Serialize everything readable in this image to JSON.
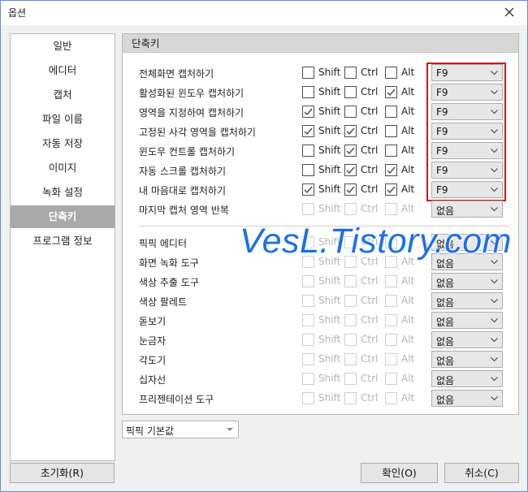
{
  "window": {
    "title": "옵션"
  },
  "sidebar": {
    "items": [
      {
        "label": "일반"
      },
      {
        "label": "에디터"
      },
      {
        "label": "캡처"
      },
      {
        "label": "파일 이름"
      },
      {
        "label": "자동 저장"
      },
      {
        "label": "이미지"
      },
      {
        "label": "녹화 설정"
      },
      {
        "label": "단축키",
        "active": true
      },
      {
        "label": "프로그램 정보"
      }
    ]
  },
  "panel": {
    "header": "단축키"
  },
  "modifier_labels": {
    "shift": "Shift",
    "ctrl": "Ctrl",
    "alt": "Alt"
  },
  "capture_shortcuts": [
    {
      "label": "전체화면 캡처하기",
      "shift": false,
      "ctrl": false,
      "alt": false,
      "key": "F9"
    },
    {
      "label": "활성화된 윈도우 캡처하기",
      "shift": false,
      "ctrl": false,
      "alt": true,
      "key": "F9"
    },
    {
      "label": "영역을 지정하여 캡처하기",
      "shift": true,
      "ctrl": false,
      "alt": false,
      "key": "F9"
    },
    {
      "label": "고정된 사각 영역을 캡처하기",
      "shift": true,
      "ctrl": true,
      "alt": false,
      "key": "F9"
    },
    {
      "label": "윈도우 컨트롤 캡처하기",
      "shift": false,
      "ctrl": true,
      "alt": false,
      "key": "F9"
    },
    {
      "label": "자동 스크롤 캡처하기",
      "shift": false,
      "ctrl": true,
      "alt": true,
      "key": "F9"
    },
    {
      "label": "내 마음대로 캡처하기",
      "shift": true,
      "ctrl": true,
      "alt": true,
      "key": "F9"
    },
    {
      "label": "마지막 캡처 영역 반복",
      "shift": false,
      "ctrl": false,
      "alt": false,
      "key": "없음",
      "disabled": true
    }
  ],
  "tool_shortcuts": [
    {
      "label": "픽픽 에디터",
      "key": "없음"
    },
    {
      "label": "화면 녹화 도구",
      "key": "없음"
    },
    {
      "label": "색상 추출 도구",
      "key": "없음"
    },
    {
      "label": "색상 팔레트",
      "key": "없음"
    },
    {
      "label": "돋보기",
      "key": "없음"
    },
    {
      "label": "눈금자",
      "key": "없음"
    },
    {
      "label": "각도기",
      "key": "없음"
    },
    {
      "label": "십자선",
      "key": "없음"
    },
    {
      "label": "프리젠테이션 도구",
      "key": "없음"
    }
  ],
  "preset": {
    "value": "픽픽 기본값"
  },
  "buttons": {
    "reset": "초기화(R)",
    "ok": "확인(O)",
    "cancel": "취소(C)"
  },
  "watermark": "VesL.Tistory.com",
  "colors": {
    "highlight": "#d4141b",
    "watermark": "#1c6fe8",
    "active_sidebar": "#a9a9a9"
  }
}
